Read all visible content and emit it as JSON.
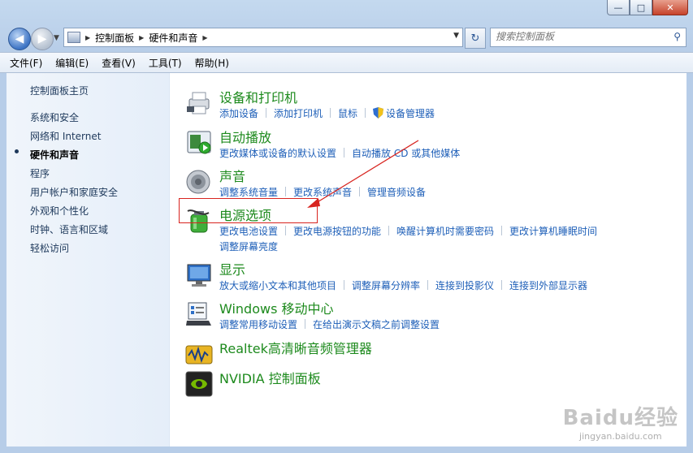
{
  "window": {
    "minimize_glyph": "—",
    "maximize_glyph": "□",
    "close_glyph": "✕"
  },
  "address": {
    "segments": [
      "控制面板",
      "硬件和声音"
    ],
    "search_placeholder": "搜索控制面板"
  },
  "menu": [
    "文件(F)",
    "编辑(E)",
    "查看(V)",
    "工具(T)",
    "帮助(H)"
  ],
  "sidebar": {
    "home": "控制面板主页",
    "items": [
      "系统和安全",
      "网络和 Internet",
      "硬件和声音",
      "程序",
      "用户帐户和家庭安全",
      "外观和个性化",
      "时钟、语言和区域",
      "轻松访问"
    ],
    "active_index": 2
  },
  "categories": [
    {
      "title": "设备和打印机",
      "icon": "printer-icon",
      "links": [
        "添加设备",
        "添加打印机",
        "鼠标",
        "设备管理器"
      ]
    },
    {
      "title": "自动播放",
      "icon": "autoplay-icon",
      "links": [
        "更改媒体或设备的默认设置",
        "自动播放 CD 或其他媒体"
      ]
    },
    {
      "title": "声音",
      "icon": "speaker-icon",
      "links": [
        "调整系统音量",
        "更改系统声音",
        "管理音频设备"
      ]
    },
    {
      "title": "电源选项",
      "icon": "battery-icon",
      "links": [
        "更改电池设置",
        "更改电源按钮的功能",
        "唤醒计算机时需要密码",
        "更改计算机睡眠时间",
        "调整屏幕亮度"
      ]
    },
    {
      "title": "显示",
      "icon": "display-icon",
      "links": [
        "放大或缩小文本和其他项目",
        "调整屏幕分辨率",
        "连接到投影仪",
        "连接到外部显示器"
      ]
    },
    {
      "title": "Windows 移动中心",
      "icon": "mobility-center-icon",
      "links": [
        "调整常用移动设置",
        "在给出演示文稿之前调整设置"
      ]
    },
    {
      "title": "Realtek高清晰音频管理器",
      "icon": "realtek-audio-icon",
      "links": []
    },
    {
      "title": "NVIDIA 控制面板",
      "icon": "nvidia-icon",
      "links": []
    }
  ],
  "watermark": {
    "brand": "Baidu经验",
    "url": "jingyan.baidu.com"
  },
  "colors": {
    "category_title": "#1d8a1d",
    "link": "#1e5fb8",
    "highlight": "#d8241f"
  }
}
